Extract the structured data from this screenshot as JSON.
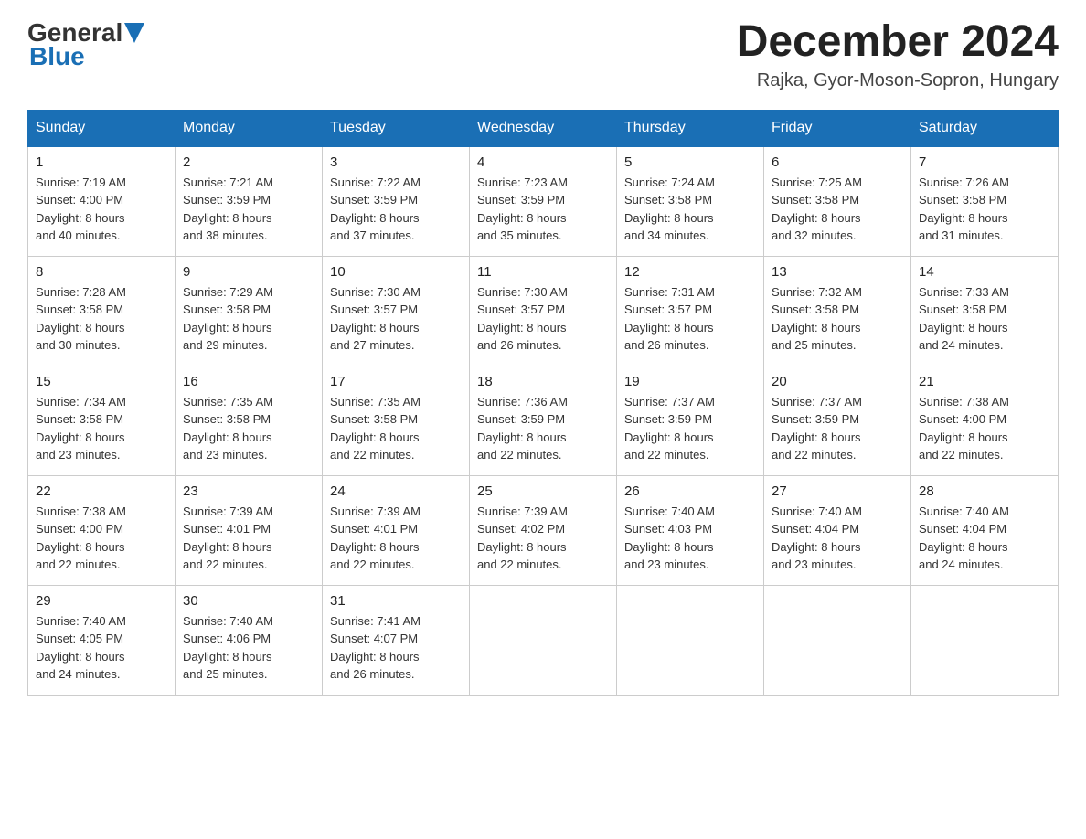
{
  "logo": {
    "general": "General",
    "blue": "Blue"
  },
  "title": "December 2024",
  "location": "Rajka, Gyor-Moson-Sopron, Hungary",
  "days_of_week": [
    "Sunday",
    "Monday",
    "Tuesday",
    "Wednesday",
    "Thursday",
    "Friday",
    "Saturday"
  ],
  "weeks": [
    [
      {
        "day": "1",
        "sunrise": "7:19 AM",
        "sunset": "4:00 PM",
        "daylight": "8 hours and 40 minutes."
      },
      {
        "day": "2",
        "sunrise": "7:21 AM",
        "sunset": "3:59 PM",
        "daylight": "8 hours and 38 minutes."
      },
      {
        "day": "3",
        "sunrise": "7:22 AM",
        "sunset": "3:59 PM",
        "daylight": "8 hours and 37 minutes."
      },
      {
        "day": "4",
        "sunrise": "7:23 AM",
        "sunset": "3:59 PM",
        "daylight": "8 hours and 35 minutes."
      },
      {
        "day": "5",
        "sunrise": "7:24 AM",
        "sunset": "3:58 PM",
        "daylight": "8 hours and 34 minutes."
      },
      {
        "day": "6",
        "sunrise": "7:25 AM",
        "sunset": "3:58 PM",
        "daylight": "8 hours and 32 minutes."
      },
      {
        "day": "7",
        "sunrise": "7:26 AM",
        "sunset": "3:58 PM",
        "daylight": "8 hours and 31 minutes."
      }
    ],
    [
      {
        "day": "8",
        "sunrise": "7:28 AM",
        "sunset": "3:58 PM",
        "daylight": "8 hours and 30 minutes."
      },
      {
        "day": "9",
        "sunrise": "7:29 AM",
        "sunset": "3:58 PM",
        "daylight": "8 hours and 29 minutes."
      },
      {
        "day": "10",
        "sunrise": "7:30 AM",
        "sunset": "3:57 PM",
        "daylight": "8 hours and 27 minutes."
      },
      {
        "day": "11",
        "sunrise": "7:30 AM",
        "sunset": "3:57 PM",
        "daylight": "8 hours and 26 minutes."
      },
      {
        "day": "12",
        "sunrise": "7:31 AM",
        "sunset": "3:57 PM",
        "daylight": "8 hours and 26 minutes."
      },
      {
        "day": "13",
        "sunrise": "7:32 AM",
        "sunset": "3:58 PM",
        "daylight": "8 hours and 25 minutes."
      },
      {
        "day": "14",
        "sunrise": "7:33 AM",
        "sunset": "3:58 PM",
        "daylight": "8 hours and 24 minutes."
      }
    ],
    [
      {
        "day": "15",
        "sunrise": "7:34 AM",
        "sunset": "3:58 PM",
        "daylight": "8 hours and 23 minutes."
      },
      {
        "day": "16",
        "sunrise": "7:35 AM",
        "sunset": "3:58 PM",
        "daylight": "8 hours and 23 minutes."
      },
      {
        "day": "17",
        "sunrise": "7:35 AM",
        "sunset": "3:58 PM",
        "daylight": "8 hours and 22 minutes."
      },
      {
        "day": "18",
        "sunrise": "7:36 AM",
        "sunset": "3:59 PM",
        "daylight": "8 hours and 22 minutes."
      },
      {
        "day": "19",
        "sunrise": "7:37 AM",
        "sunset": "3:59 PM",
        "daylight": "8 hours and 22 minutes."
      },
      {
        "day": "20",
        "sunrise": "7:37 AM",
        "sunset": "3:59 PM",
        "daylight": "8 hours and 22 minutes."
      },
      {
        "day": "21",
        "sunrise": "7:38 AM",
        "sunset": "4:00 PM",
        "daylight": "8 hours and 22 minutes."
      }
    ],
    [
      {
        "day": "22",
        "sunrise": "7:38 AM",
        "sunset": "4:00 PM",
        "daylight": "8 hours and 22 minutes."
      },
      {
        "day": "23",
        "sunrise": "7:39 AM",
        "sunset": "4:01 PM",
        "daylight": "8 hours and 22 minutes."
      },
      {
        "day": "24",
        "sunrise": "7:39 AM",
        "sunset": "4:01 PM",
        "daylight": "8 hours and 22 minutes."
      },
      {
        "day": "25",
        "sunrise": "7:39 AM",
        "sunset": "4:02 PM",
        "daylight": "8 hours and 22 minutes."
      },
      {
        "day": "26",
        "sunrise": "7:40 AM",
        "sunset": "4:03 PM",
        "daylight": "8 hours and 23 minutes."
      },
      {
        "day": "27",
        "sunrise": "7:40 AM",
        "sunset": "4:04 PM",
        "daylight": "8 hours and 23 minutes."
      },
      {
        "day": "28",
        "sunrise": "7:40 AM",
        "sunset": "4:04 PM",
        "daylight": "8 hours and 24 minutes."
      }
    ],
    [
      {
        "day": "29",
        "sunrise": "7:40 AM",
        "sunset": "4:05 PM",
        "daylight": "8 hours and 24 minutes."
      },
      {
        "day": "30",
        "sunrise": "7:40 AM",
        "sunset": "4:06 PM",
        "daylight": "8 hours and 25 minutes."
      },
      {
        "day": "31",
        "sunrise": "7:41 AM",
        "sunset": "4:07 PM",
        "daylight": "8 hours and 26 minutes."
      },
      null,
      null,
      null,
      null
    ]
  ],
  "labels": {
    "sunrise": "Sunrise:",
    "sunset": "Sunset:",
    "daylight": "Daylight:"
  }
}
